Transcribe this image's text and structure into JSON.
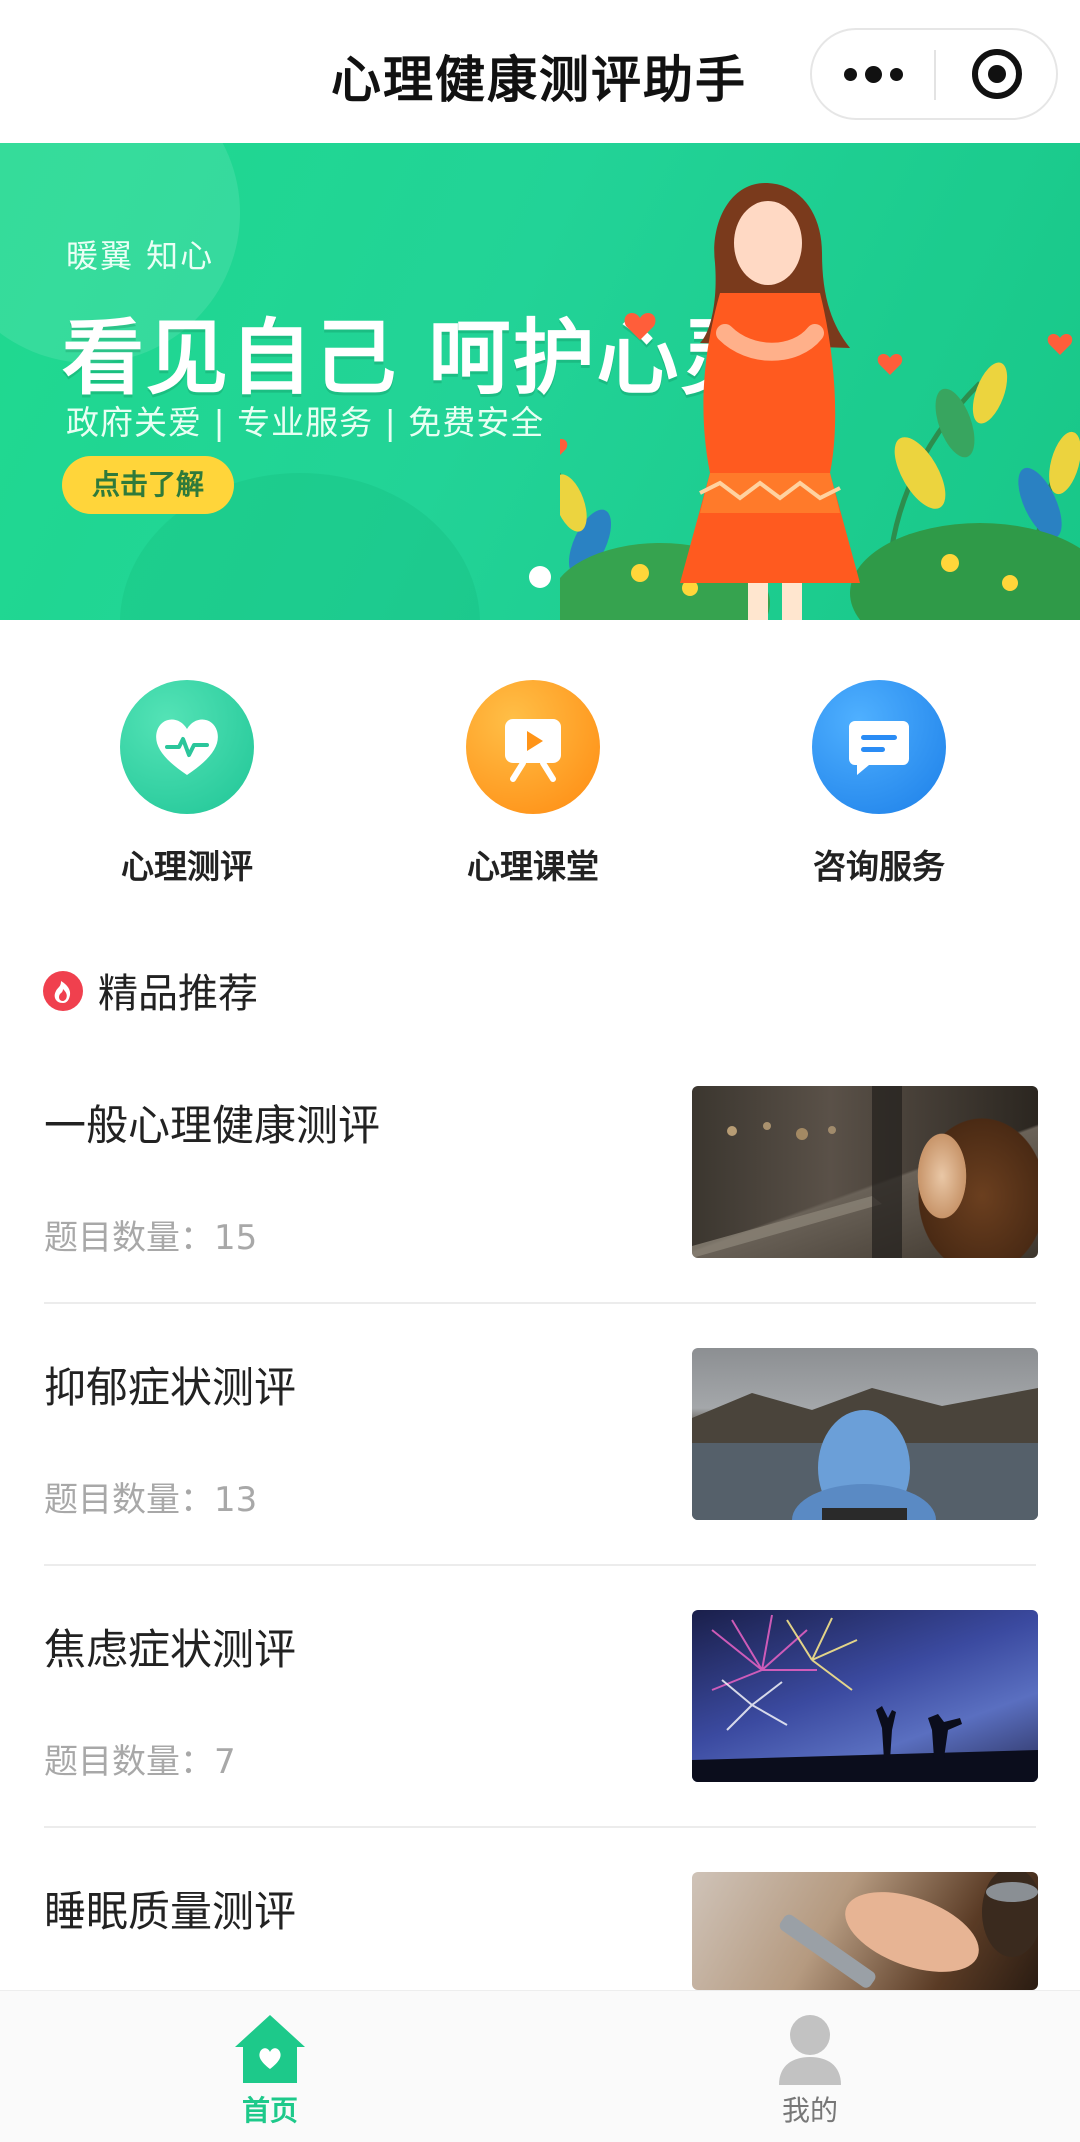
{
  "navbar": {
    "title": "心理健康测评助手",
    "more_icon": "more-dots-icon",
    "close_icon": "target-close-icon"
  },
  "banner": {
    "subtitle": "暖翼 知心",
    "headline": "看见自己 呵护心灵",
    "tags": "政府关爱 | 专业服务 | 免费安全",
    "cta": "点击了解",
    "indicator_count": 1,
    "active_indicator": 1
  },
  "quick_entries": [
    {
      "label": "心理测评",
      "icon": "heart-pulse-icon",
      "color": "#2dcfa0"
    },
    {
      "label": "心理课堂",
      "icon": "video-play-board-icon",
      "color": "#ff9b1a"
    },
    {
      "label": "咨询服务",
      "icon": "chat-bubble-icon",
      "color": "#2a8cf5"
    }
  ],
  "section": {
    "title": "精品推荐",
    "icon": "fire-icon",
    "icon_color": "#f0404e"
  },
  "assessments": [
    {
      "title": "一般心理健康测评",
      "meta": "题目数量：15",
      "thumb": "woman-by-window-photo"
    },
    {
      "title": "抑郁症状测评",
      "meta": "题目数量：13",
      "thumb": "hooded-person-lake-photo"
    },
    {
      "title": "焦虑症状测评",
      "meta": "题目数量：7",
      "thumb": "fireworks-silhouettes-photo"
    },
    {
      "title": "睡眠质量测评",
      "meta": "",
      "thumb": "hand-phone-coffee-photo"
    }
  ],
  "tabbar": {
    "home_label": "首页",
    "mine_label": "我的",
    "active_color": "#1dc98a"
  }
}
